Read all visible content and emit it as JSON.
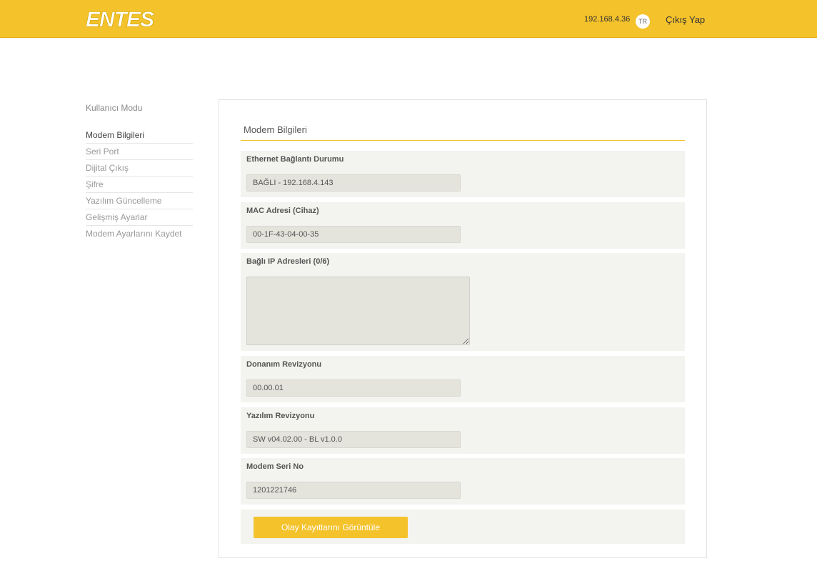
{
  "header": {
    "logo_text": "ENTES",
    "ip": "192.168.4.36",
    "language": "TR",
    "logout_label": "Çıkış Yap"
  },
  "sidebar": {
    "mode_label": "Kullanıcı Modu",
    "items": [
      {
        "label": "Modem Bilgileri",
        "active": true
      },
      {
        "label": "Seri Port"
      },
      {
        "label": "Dijital Çıkış"
      },
      {
        "label": "Şifre"
      },
      {
        "label": "Yazılım Güncelleme"
      },
      {
        "label": "Gelişmiş Ayarlar"
      },
      {
        "label": "Modem Ayarlarını Kaydet"
      }
    ]
  },
  "main": {
    "title": "Modem Bilgileri",
    "fields": {
      "ethernet": {
        "label": "Ethernet Bağlantı Durumu",
        "value": "BAĞLI - 192.168.4.143"
      },
      "mac": {
        "label": "MAC Adresi (Cihaz)",
        "value": "00-1F-43-04-00-35"
      },
      "connected_ips": {
        "label": "Bağlı IP Adresleri (0/6)",
        "value": ""
      },
      "hardware_rev": {
        "label": "Donanım Revizyonu",
        "value": "00.00.01"
      },
      "software_rev": {
        "label": "Yazılım Revizyonu",
        "value": "SW v04.02.00 - BL v1.0.0"
      },
      "serial_no": {
        "label": "Modem Seri No",
        "value": "1201221746"
      }
    },
    "log_button_label": "Olay Kayıtlarını Görüntüle"
  },
  "colors": {
    "accent": "#f4c22b",
    "field_bg": "#f3f3f0",
    "input_bg": "#e4e4dc"
  }
}
